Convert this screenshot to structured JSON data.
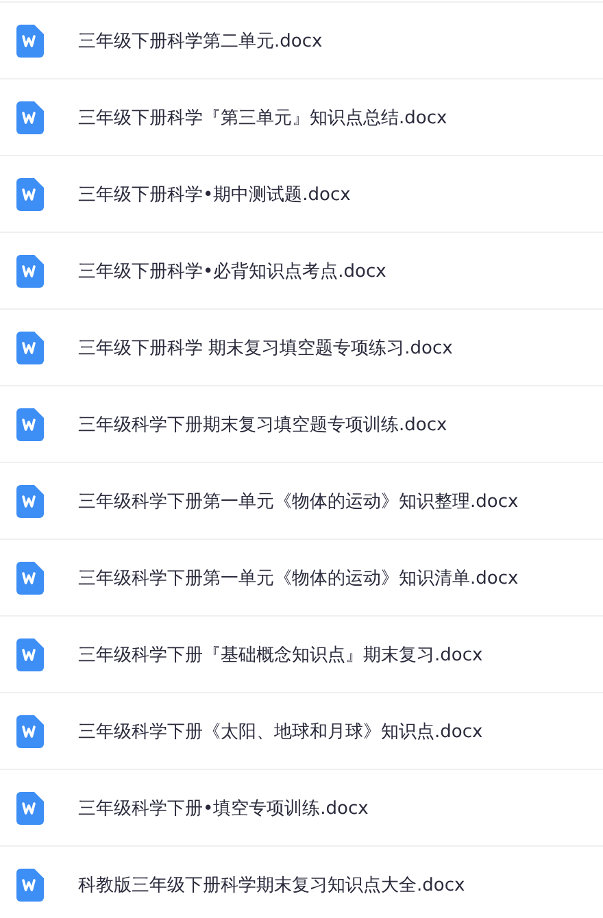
{
  "files": [
    {
      "name": "三年级下册科学第二单元.docx"
    },
    {
      "name": "三年级下册科学『第三单元』知识点总结.docx"
    },
    {
      "name": "三年级下册科学•期中测试题.docx"
    },
    {
      "name": "三年级下册科学•必背知识点考点.docx"
    },
    {
      "name": "三年级下册科学 期末复习填空题专项练习.docx"
    },
    {
      "name": "三年级科学下册期末复习填空题专项训练.docx"
    },
    {
      "name": "三年级科学下册第一单元《物体的运动》知识整理.docx"
    },
    {
      "name": "三年级科学下册第一单元《物体的运动》知识清单.docx"
    },
    {
      "name": "三年级科学下册『基础概念知识点』期末复习.docx"
    },
    {
      "name": "三年级科学下册《太阳、地球和月球》知识点.docx"
    },
    {
      "name": "三年级科学下册•填空专项训练.docx"
    },
    {
      "name": "科教版三年级下册科学期末复习知识点大全.docx"
    }
  ]
}
